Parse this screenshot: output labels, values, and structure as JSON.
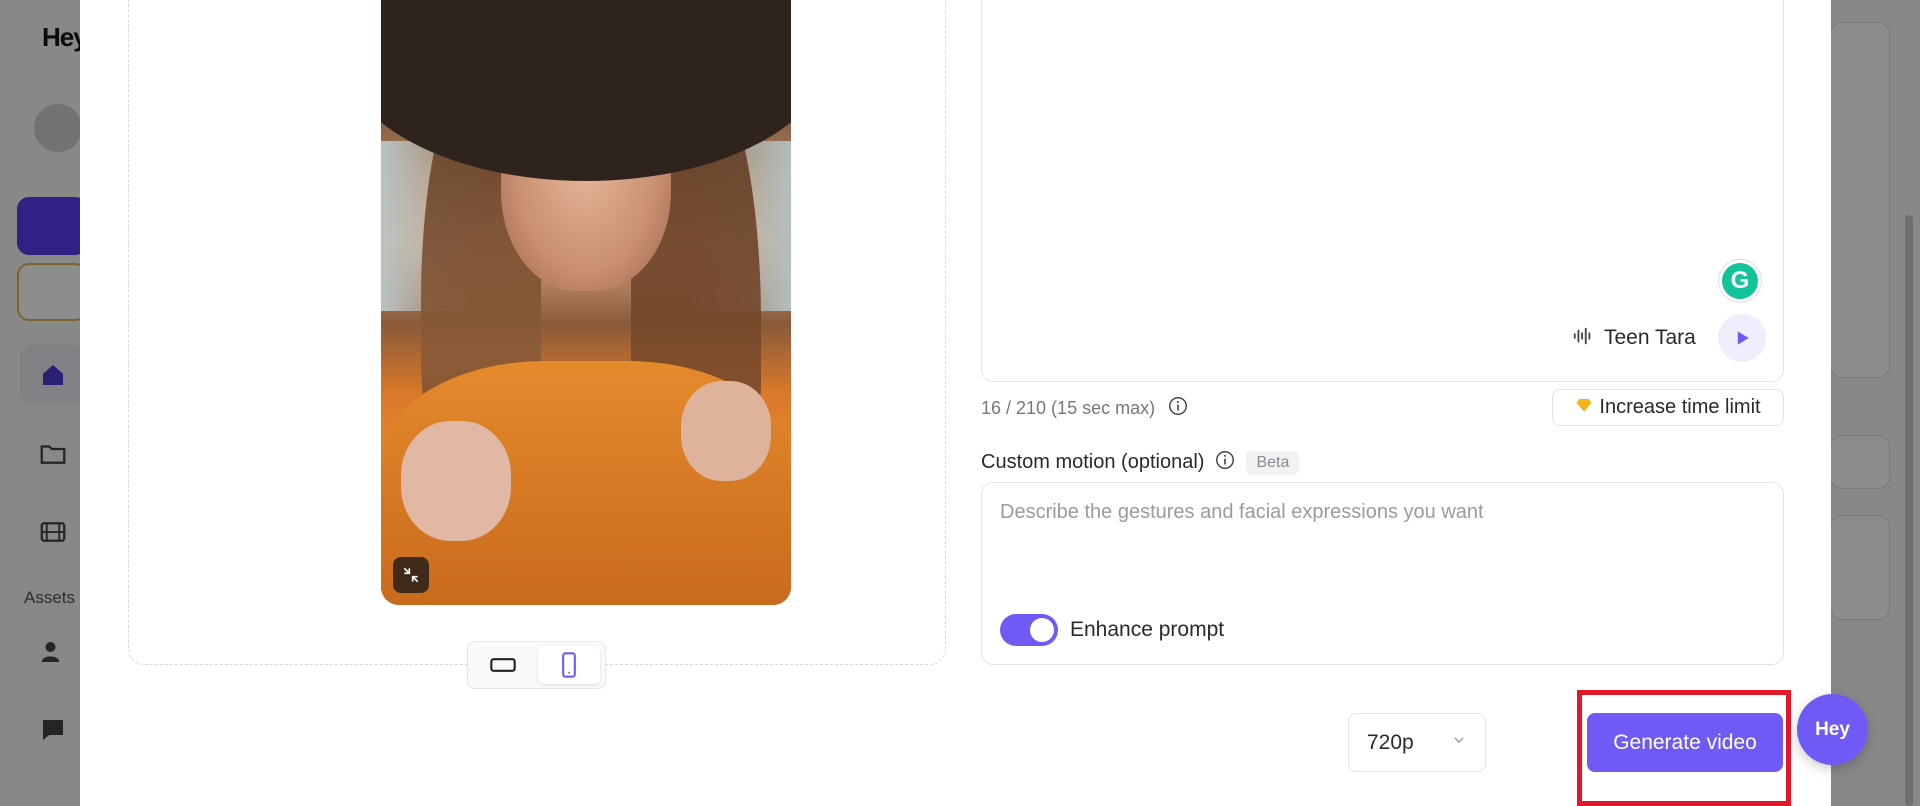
{
  "background": {
    "logo_text": "Hey",
    "assets_label": "Assets"
  },
  "script": {
    "voice_name": "Teen Tara",
    "char_count": "16 / 210 (15 sec max)",
    "increase_time_limit_label": "Increase time limit"
  },
  "custom_motion": {
    "label": "Custom motion (optional)",
    "badge": "Beta",
    "placeholder": "Describe the gestures and facial expressions you want",
    "value": "",
    "enhance_label": "Enhance prompt",
    "enhance_enabled": true
  },
  "footer": {
    "resolution": "720p",
    "generate_label": "Generate video",
    "fab_text": "Hey"
  },
  "grammarly_letter": "G",
  "colors": {
    "accent": "#6f5af6",
    "highlight": "#e0182a",
    "grammarly": "#15c39a"
  }
}
